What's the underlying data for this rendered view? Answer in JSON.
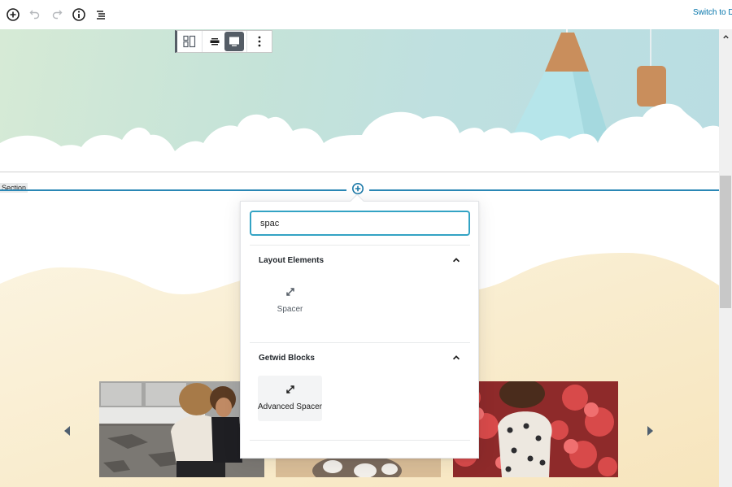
{
  "topbar": {
    "buttons": [
      {
        "name": "add-block",
        "icon": "plus-circle-icon"
      },
      {
        "name": "undo",
        "icon": "undo-icon"
      },
      {
        "name": "redo",
        "icon": "redo-icon"
      },
      {
        "name": "info",
        "icon": "info-icon"
      },
      {
        "name": "block-navigation",
        "icon": "list-icon"
      }
    ],
    "switch_link": "Switch to D"
  },
  "block_toolbar": {
    "buttons": [
      {
        "name": "change-block-type",
        "icon": "media-text-icon"
      },
      {
        "name": "align-wide",
        "icon": "align-wide-icon"
      },
      {
        "name": "align-full",
        "icon": "align-full-icon",
        "active": true
      },
      {
        "name": "more-options",
        "icon": "ellipsis-vertical-icon"
      }
    ]
  },
  "section_label": "Section",
  "inserter": {
    "search_value": "spac",
    "panels": [
      {
        "title": "Layout Elements",
        "expanded": true,
        "items": [
          {
            "label": "Spacer",
            "icon": "resize-arrows-icon"
          }
        ]
      },
      {
        "title": "Getwid Blocks",
        "expanded": true,
        "items": [
          {
            "label": "Advanced Spacer",
            "icon": "resize-arrows-icon",
            "hovered": true
          }
        ]
      }
    ]
  },
  "gallery": {
    "images": [
      {
        "alt": "Woman whispering to child"
      },
      {
        "alt": "Stuffed toy"
      },
      {
        "alt": "Girl in polka-dot shirt among red flowers"
      }
    ],
    "prev_arrow": "caret-left-icon",
    "next_arrow": "caret-right-icon"
  },
  "colors": {
    "accent": "#2a87b5",
    "search_border": "#33a3c4",
    "link": "#0073aa",
    "toolbar_active": "#555d66",
    "cream": "#f9efd6"
  }
}
